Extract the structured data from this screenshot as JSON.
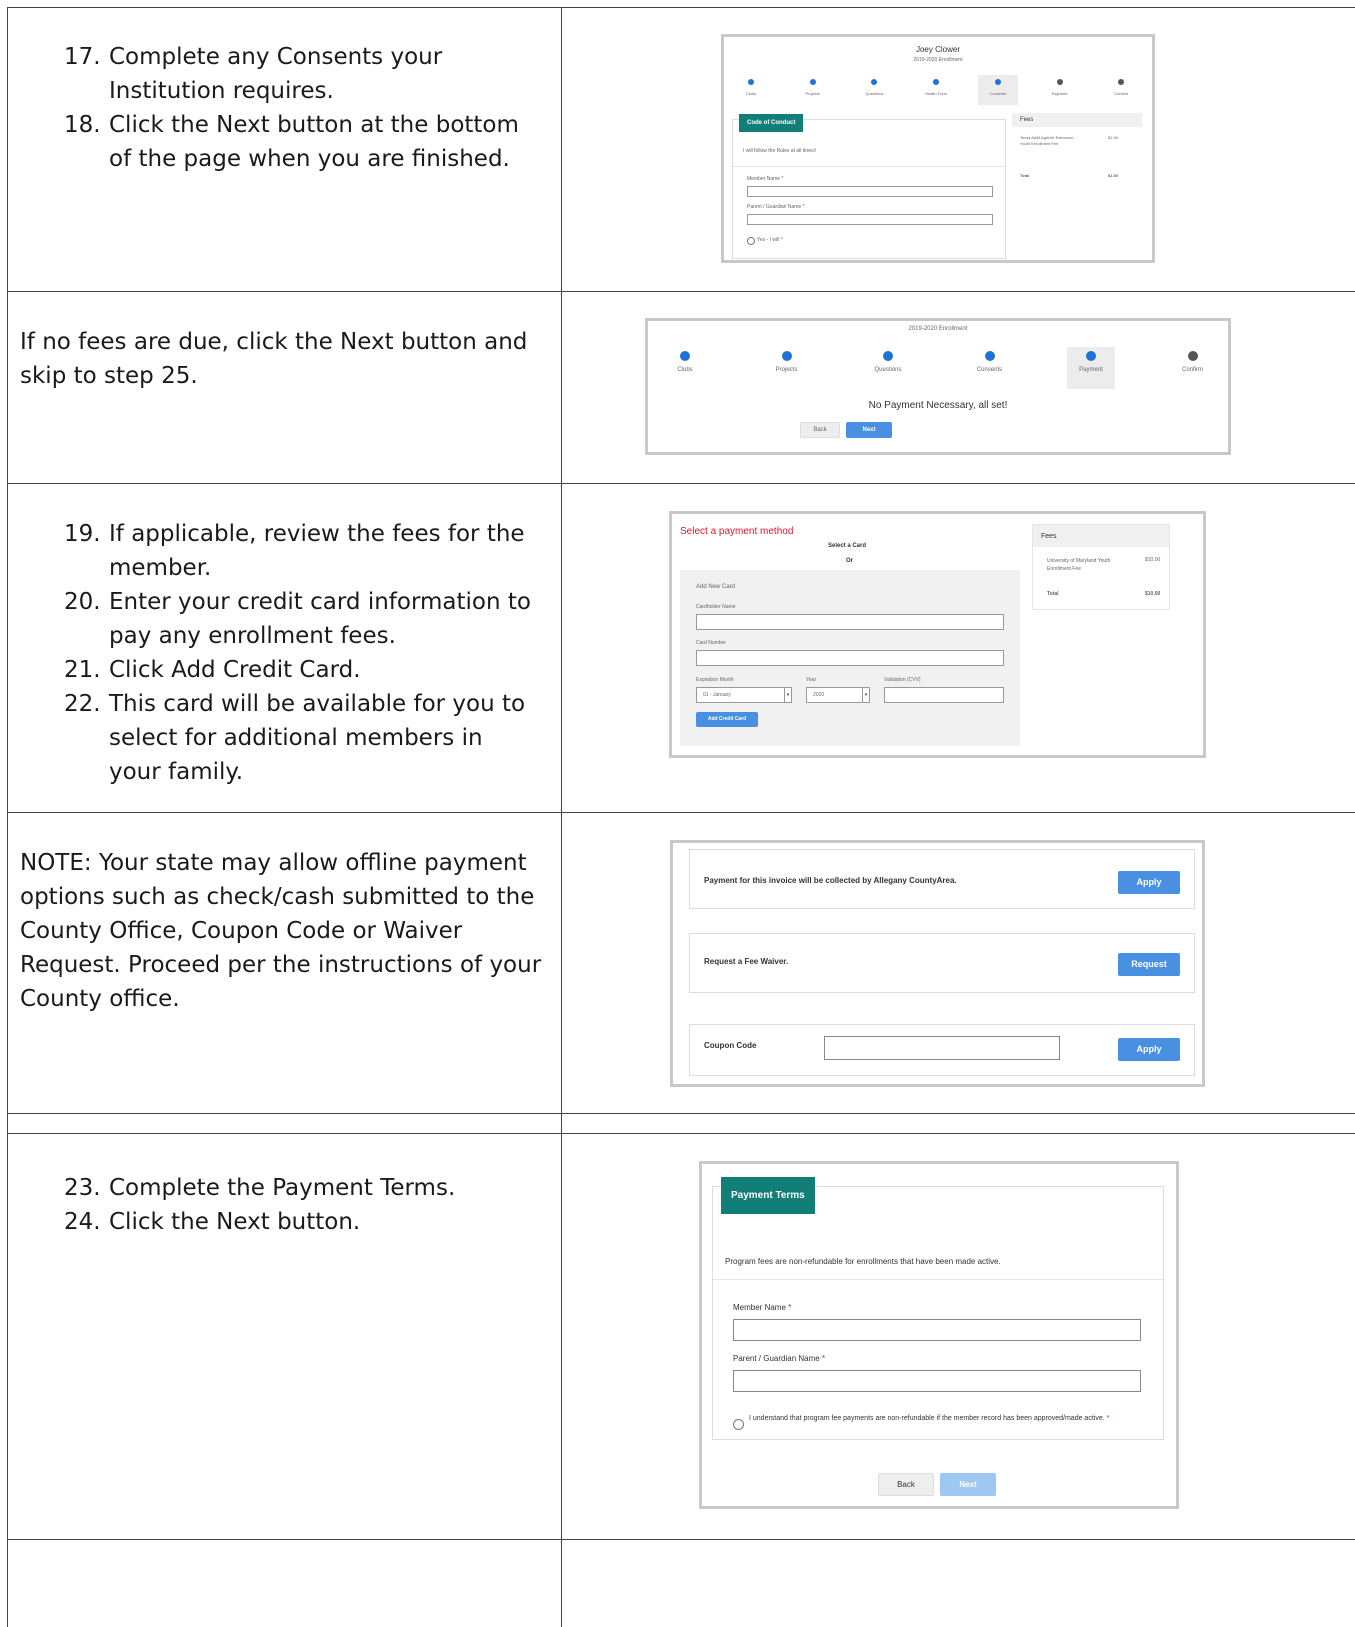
{
  "rows": [
    {
      "left": {
        "items": [
          {
            "num": "17.",
            "text": "Complete any Consents your Institution requires."
          },
          {
            "num": "18.",
            "text": "Click the Next button at the bottom of the page when you are finished."
          }
        ]
      },
      "screenshot": {
        "member_name": "Joey Clower",
        "subtitle": "2019-2020 Enrollment",
        "steps": [
          "Clubs",
          "Projects",
          "Questions",
          "Health Form",
          "Consents",
          "Payment",
          "Confirm"
        ],
        "tab_label": "Code of Conduct",
        "intro_text": "I will follow the Rules at all times!",
        "field1_label": "Member Name *",
        "field2_label": "Parent / Guardian Name *",
        "radio_label": "Yes - I will *",
        "fees_title": "Fees",
        "fee_desc": "Texas A&M AgriLife Extension - Youth Enrollment Fee",
        "fee_amount": "$1.50",
        "total_label": "Total",
        "total_amount": "$1.50"
      }
    },
    {
      "left": {
        "text": "If no fees are due, click the Next button and skip to step 25."
      },
      "screenshot": {
        "subtitle": "2019-2020 Enrollment",
        "steps": [
          "Clubs",
          "Projects",
          "Questions",
          "Consents",
          "Payment",
          "Confirm"
        ],
        "message": "No Payment Necessary, all set!",
        "back": "Back",
        "next": "Next"
      }
    },
    {
      "left": {
        "items": [
          {
            "num": "19.",
            "text": "If applicable, review the fees for the member."
          },
          {
            "num": "20.",
            "text": "Enter your credit card information to pay any enrollment fees."
          },
          {
            "num": "21.",
            "text": "Click Add Credit Card."
          },
          {
            "num": "22.",
            "text": "This card will be available for you to select for additional members in your family."
          }
        ]
      },
      "screenshot": {
        "heading": "Select a payment method",
        "select_card": "Select a Card",
        "or": "Or",
        "add_new_card": "Add New Card",
        "cardholder_label": "Cardholder Name",
        "card_number_label": "Card Number",
        "exp_month_label": "Expiration Month",
        "year_label": "Year",
        "cvv_label": "Validation (CVV)",
        "month_value": "01 - January",
        "year_value": "2020",
        "add_button": "Add Credit Card",
        "fees_title": "Fees",
        "fee_desc": "University of Maryland Youth Enrollment Fee",
        "fee_amount": "$10.00",
        "total_label": "Total",
        "total_amount": "$10.00"
      }
    },
    {
      "left": {
        "text": "NOTE: Your state may allow offline payment options such as check/cash submitted to the County Office, Coupon Code or Waiver Request. Proceed per the instructions of your County office."
      },
      "screenshot": {
        "offline_text": "Payment for this invoice will be collected by Allegany CountyArea.",
        "apply1": "Apply",
        "waiver_text": "Request a Fee Waiver.",
        "request": "Request",
        "coupon_label": "Coupon Code",
        "apply2": "Apply"
      }
    },
    {
      "left": {
        "items": [
          {
            "num": "23.",
            "text": "Complete the Payment Terms."
          },
          {
            "num": "24.",
            "text": "Click the Next button."
          }
        ]
      },
      "screenshot": {
        "tab_label": "Payment Terms",
        "intro_text": "Program fees are non-refundable for enrollments that have been made active.",
        "field1_label": "Member Name",
        "field2_label": "Parent / Guardian Name",
        "required_mark": "*",
        "checkbox_text": "I understand that program fee payments are non-refundable if the member record has been approved/made active.",
        "back": "Back",
        "next": "Next"
      }
    }
  ],
  "colors": {
    "teal": "#127e78",
    "blue_button": "#4a90e2",
    "red_heading": "#e0142b",
    "step_blue": "#1e73d8",
    "step_gray": "#555555"
  }
}
